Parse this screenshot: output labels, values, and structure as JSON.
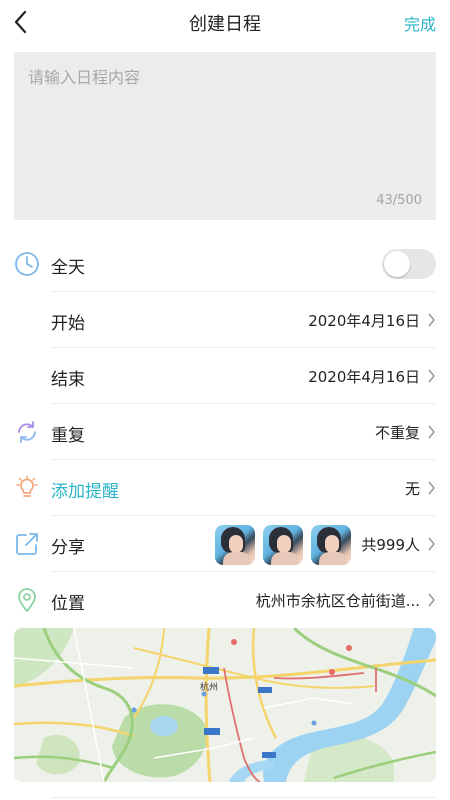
{
  "header": {
    "title": "创建日程",
    "done_label": "完成"
  },
  "editor": {
    "placeholder": "请输入日程内容",
    "counter": "43/500"
  },
  "rows": {
    "allday": {
      "label": "全天",
      "toggle_on": false
    },
    "start": {
      "label": "开始",
      "value": "2020年4月16日"
    },
    "end": {
      "label": "结束",
      "value": "2020年4月16日"
    },
    "repeat": {
      "label": "重复",
      "value": "不重复"
    },
    "reminder": {
      "label": "添加提醒",
      "value": "无"
    },
    "share": {
      "label": "分享",
      "value": "共999人",
      "avatars": [
        "avatar",
        "avatar",
        "avatar"
      ]
    },
    "location": {
      "label": "位置",
      "value": "杭州市余杭区仓前街道..."
    }
  },
  "map": {
    "city_label": "杭州"
  },
  "colors": {
    "accent": "#2bb5c7",
    "reminder": "#f4a477",
    "icon_blue": "#7bb7ea",
    "repeat_purple": "#a88fe8",
    "location_green": "#8bd3a0"
  },
  "icons": {
    "back": "chevron-left-icon",
    "allday": "clock-icon",
    "repeat": "repeat-icon",
    "reminder": "lightbulb-icon",
    "share": "share-icon",
    "location": "location-pin-icon",
    "chevron": "chevron-right-icon"
  }
}
